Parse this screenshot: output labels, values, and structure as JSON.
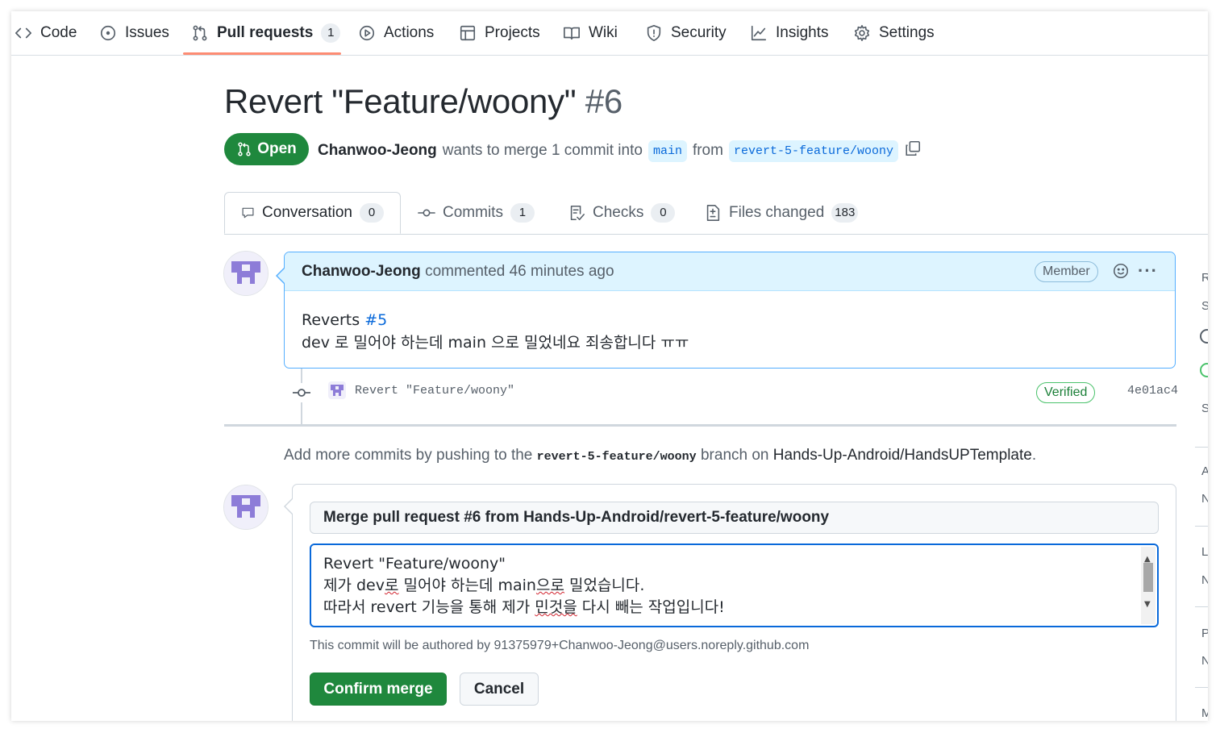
{
  "nav": {
    "items": [
      {
        "label": "Code",
        "icon": "code-icon"
      },
      {
        "label": "Issues",
        "icon": "issue-icon"
      },
      {
        "label": "Pull requests",
        "icon": "pull-request-icon",
        "count": "1",
        "active": true
      },
      {
        "label": "Actions",
        "icon": "play-icon"
      },
      {
        "label": "Projects",
        "icon": "table-icon"
      },
      {
        "label": "Wiki",
        "icon": "book-icon"
      },
      {
        "label": "Security",
        "icon": "shield-icon"
      },
      {
        "label": "Insights",
        "icon": "graph-icon"
      },
      {
        "label": "Settings",
        "icon": "gear-icon"
      }
    ]
  },
  "pr": {
    "title": "Revert \"Feature/woony\"",
    "number": "#6",
    "state": "Open",
    "author": "Chanwoo-Jeong",
    "meta_text": "wants to merge 1 commit into",
    "base_branch": "main",
    "from_text": "from",
    "head_branch": "revert-5-feature/woony"
  },
  "tabs": [
    {
      "label": "Conversation",
      "count": "0",
      "icon": "comment-icon"
    },
    {
      "label": "Commits",
      "count": "1",
      "icon": "commit-icon"
    },
    {
      "label": "Checks",
      "count": "0",
      "icon": "checklist-icon"
    },
    {
      "label": "Files changed",
      "count": "183",
      "icon": "file-diff-icon"
    }
  ],
  "comment": {
    "author": "Chanwoo-Jeong",
    "action": "commented 46 minutes ago",
    "role": "Member",
    "reverts_label": "Reverts",
    "reverts_ref": "#5",
    "body_line2": "dev 로 밀어야 하는데 main 으로 밀었네요 죄송합니다 ㅠㅠ"
  },
  "commit": {
    "message": "Revert \"Feature/woony\"",
    "verified": "Verified",
    "sha": "4e01ac4"
  },
  "add_more": {
    "prefix": "Add more commits by pushing to the",
    "branch": "revert-5-feature/woony",
    "middle": "branch on",
    "repo": "Hands-Up-Android/HandsUPTemplate",
    "suffix": "."
  },
  "merge": {
    "title_value": "Merge pull request #6 from Hands-Up-Android/revert-5-feature/woony",
    "msg_line1": "Revert \"Feature/woony\"",
    "msg_line2_a": "제가 dev",
    "msg_line2_b": "로",
    "msg_line2_c": " 밀어야 하는데 main",
    "msg_line2_d": "으로",
    "msg_line2_e": " 밀었습니다.",
    "msg_line3_a": "따라서 revert 기능을 통해 제가 ",
    "msg_line3_b": "민것을",
    "msg_line3_c": " 다시 빼는 작업입니다!",
    "author_note": "This commit will be authored by 91375979+Chanwoo-Jeong@users.noreply.github.com",
    "confirm_label": "Confirm merge",
    "cancel_label": "Cancel"
  },
  "sidebar_fragments": [
    "R",
    "S",
    "S",
    "A",
    "N",
    "L",
    "N",
    "P",
    "N",
    "M"
  ],
  "colors": {
    "open_green": "#1f883d",
    "link_blue": "#0969da",
    "comment_header_bg": "#ddf4ff",
    "nav_underline": "#fd8c73"
  }
}
